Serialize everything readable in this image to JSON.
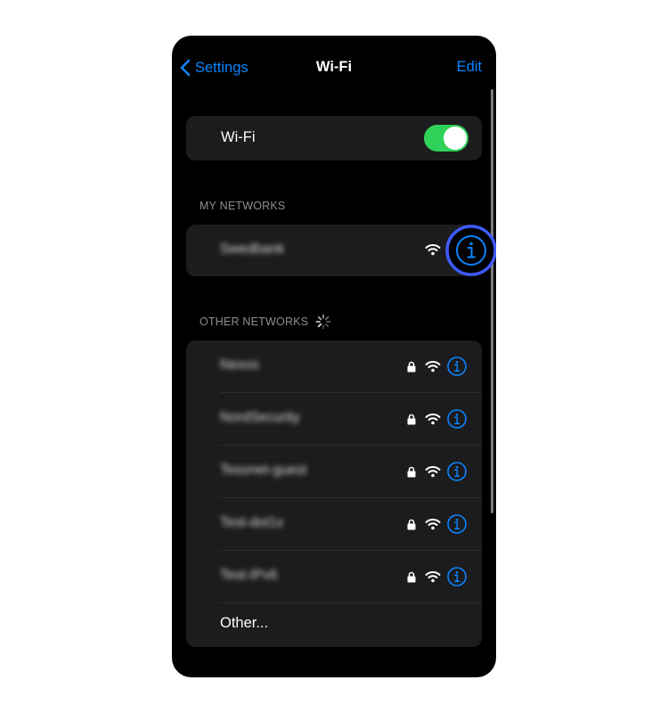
{
  "nav": {
    "back_label": "Settings",
    "title": "Wi-Fi",
    "edit_label": "Edit"
  },
  "wifi_toggle": {
    "label": "Wi-Fi",
    "on": true
  },
  "my_networks": {
    "header": "MY NETWORKS",
    "items": [
      {
        "name": "Swedbank",
        "secured": false
      }
    ]
  },
  "other_networks": {
    "header": "OTHER NETWORKS",
    "items": [
      {
        "name": "Nexos",
        "secured": true
      },
      {
        "name": "NordSecurity",
        "secured": true
      },
      {
        "name": "Tesonet-guest",
        "secured": true
      },
      {
        "name": "Test-dot1x",
        "secured": true
      },
      {
        "name": "Test-IPv6",
        "secured": true
      }
    ],
    "other_label": "Other..."
  },
  "colors": {
    "accent": "#0a84ff",
    "toggle_on": "#30d158",
    "highlight_ring": "#3d5afe",
    "background": "#000000",
    "cell": "#1c1c1e"
  },
  "icons": [
    "chevron-left-icon",
    "wifi-icon",
    "lock-icon",
    "info-icon",
    "spinner-icon"
  ]
}
